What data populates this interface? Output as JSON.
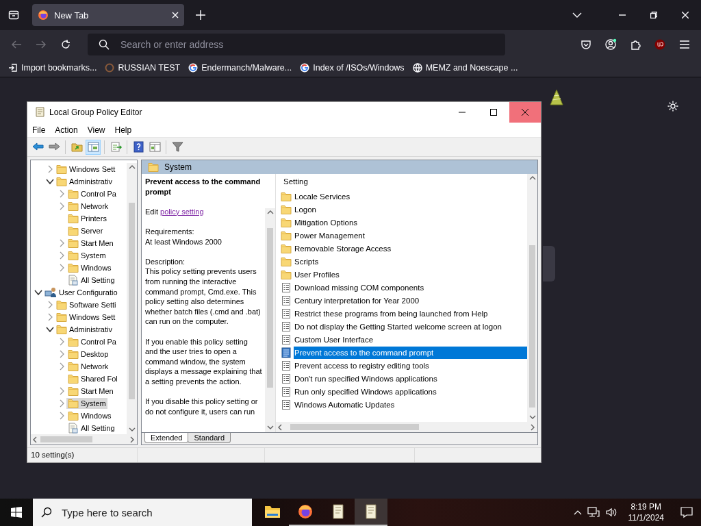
{
  "browser": {
    "tabs": [
      {
        "title": "New Tab",
        "selected": true
      }
    ],
    "address_bar": {
      "placeholder": "Search or enter address"
    },
    "bookmarks": [
      {
        "label": "Import bookmarks...",
        "kind": "import"
      },
      {
        "label": "RUSSIAN TEST",
        "kind": "site"
      },
      {
        "label": "Endermanch/Malware...",
        "kind": "google"
      },
      {
        "label": "Index of /ISOs/Windows",
        "kind": "google"
      },
      {
        "label": "MEMZ and Noescape ...",
        "kind": "globe"
      }
    ]
  },
  "policy_editor": {
    "title": "Local Group Policy Editor",
    "menu": [
      "File",
      "Action",
      "View",
      "Help"
    ],
    "toolbar": [
      [
        {
          "kind": "back",
          "selected": false
        },
        {
          "kind": "forward",
          "selected": false
        }
      ],
      [
        {
          "kind": "up",
          "selected": false
        },
        {
          "kind": "tree",
          "selected": true
        }
      ],
      [
        {
          "kind": "export",
          "selected": false
        }
      ],
      [
        {
          "kind": "help",
          "selected": false
        },
        {
          "kind": "properties",
          "selected": false
        }
      ],
      [
        {
          "kind": "filter",
          "selected": false
        }
      ]
    ],
    "tree": {
      "items": [
        {
          "children": [
            {
              "label": "Windows Sett",
              "kind": "folder",
              "expandable": true,
              "expanded": false,
              "selected": false
            },
            {
              "label": "Administrativ",
              "kind": "folder",
              "expandable": true,
              "expanded": true,
              "selected": false,
              "children": [
                {
                  "label": "Control Pa",
                  "kind": "folder",
                  "expandable": true,
                  "expanded": false,
                  "selected": false
                },
                {
                  "label": "Network",
                  "kind": "folder",
                  "expandable": true,
                  "expanded": false,
                  "selected": false
                },
                {
                  "label": "Printers",
                  "kind": "folder",
                  "expandable": false,
                  "selected": false
                },
                {
                  "label": "Server",
                  "kind": "folder",
                  "expandable": false,
                  "selected": false
                },
                {
                  "label": "Start Men",
                  "kind": "folder",
                  "expandable": true,
                  "expanded": false,
                  "selected": false
                },
                {
                  "label": "System",
                  "kind": "folder",
                  "expandable": true,
                  "expanded": false,
                  "selected": false
                },
                {
                  "label": "Windows",
                  "kind": "folder",
                  "expandable": true,
                  "expanded": false,
                  "selected": false
                },
                {
                  "label": "All Setting",
                  "kind": "all-settings",
                  "expandable": false,
                  "selected": false
                }
              ]
            }
          ]
        },
        {
          "label": "User Configuratio",
          "kind": "user-config",
          "expandable": true,
          "expanded": true,
          "selected": false,
          "children": [
            {
              "label": "Software Setti",
              "kind": "folder",
              "expandable": true,
              "expanded": false,
              "selected": false
            },
            {
              "label": "Windows Sett",
              "kind": "folder",
              "expandable": true,
              "expanded": false,
              "selected": false
            },
            {
              "label": "Administrativ",
              "kind": "folder",
              "expandable": true,
              "expanded": true,
              "selected": false,
              "children": [
                {
                  "label": "Control Pa",
                  "kind": "folder",
                  "expandable": true,
                  "expanded": false,
                  "selected": false
                },
                {
                  "label": "Desktop",
                  "kind": "folder",
                  "expandable": true,
                  "expanded": false,
                  "selected": false
                },
                {
                  "label": "Network",
                  "kind": "folder",
                  "expandable": true,
                  "expanded": false,
                  "selected": false
                },
                {
                  "label": "Shared Fol",
                  "kind": "folder",
                  "expandable": false,
                  "selected": false
                },
                {
                  "label": "Start Men",
                  "kind": "folder",
                  "expandable": true,
                  "expanded": false,
                  "selected": false
                },
                {
                  "label": "System",
                  "kind": "folder",
                  "expandable": true,
                  "expanded": false,
                  "selected": true
                },
                {
                  "label": "Windows",
                  "kind": "folder",
                  "expandable": true,
                  "expanded": false,
                  "selected": false
                },
                {
                  "label": "All Setting",
                  "kind": "all-settings",
                  "expandable": false,
                  "selected": false
                }
              ]
            }
          ]
        }
      ]
    },
    "header": "System",
    "description": {
      "title": "Prevent access to the command prompt",
      "edit_prefix": "Edit",
      "edit_link": "policy setting",
      "requirements_label": "Requirements:",
      "requirements": "At least Windows 2000",
      "description_label": "Description:",
      "paragraphs": [
        "This policy setting prevents users from running the interactive command prompt, Cmd.exe. This policy setting also determines whether batch files (.cmd and .bat) can run on the computer.",
        "If you enable this policy setting and the user tries to open a command window, the system displays a message explaining that a setting prevents the action.",
        "If you disable this policy setting or do not configure it, users can run"
      ]
    },
    "list": {
      "column": "Setting",
      "rows": [
        {
          "label": "Locale Services",
          "kind": "folder",
          "selected": false
        },
        {
          "label": "Logon",
          "kind": "folder",
          "selected": false
        },
        {
          "label": "Mitigation Options",
          "kind": "folder",
          "selected": false
        },
        {
          "label": "Power Management",
          "kind": "folder",
          "selected": false
        },
        {
          "label": "Removable Storage Access",
          "kind": "folder",
          "selected": false
        },
        {
          "label": "Scripts",
          "kind": "folder",
          "selected": false
        },
        {
          "label": "User Profiles",
          "kind": "folder",
          "selected": false
        },
        {
          "label": "Download missing COM components",
          "kind": "policy",
          "selected": false
        },
        {
          "label": "Century interpretation for Year 2000",
          "kind": "policy",
          "selected": false
        },
        {
          "label": "Restrict these programs from being launched from Help",
          "kind": "policy",
          "selected": false
        },
        {
          "label": "Do not display the Getting Started welcome screen at logon",
          "kind": "policy",
          "selected": false
        },
        {
          "label": "Custom User Interface",
          "kind": "policy",
          "selected": false
        },
        {
          "label": "Prevent access to the command prompt",
          "kind": "policy",
          "selected": true
        },
        {
          "label": "Prevent access to registry editing tools",
          "kind": "policy",
          "selected": false
        },
        {
          "label": "Don't run specified Windows applications",
          "kind": "policy",
          "selected": false
        },
        {
          "label": "Run only specified Windows applications",
          "kind": "policy",
          "selected": false
        },
        {
          "label": "Windows Automatic Updates",
          "kind": "policy",
          "selected": false
        }
      ]
    },
    "view_tabs": [
      {
        "label": "Extended",
        "selected": true
      },
      {
        "label": "Standard",
        "selected": false
      }
    ],
    "status": "10 setting(s)"
  },
  "taskbar": {
    "search": {
      "placeholder": "Type here to search"
    },
    "apps": [
      {
        "kind": "explorer",
        "running": false,
        "selected": false
      },
      {
        "kind": "firefox",
        "running": true,
        "selected": false
      },
      {
        "kind": "notepad",
        "running": true,
        "selected": false
      },
      {
        "kind": "notepad",
        "running": true,
        "selected": true
      }
    ],
    "time": "8:19 PM",
    "date": "11/1/2024"
  }
}
